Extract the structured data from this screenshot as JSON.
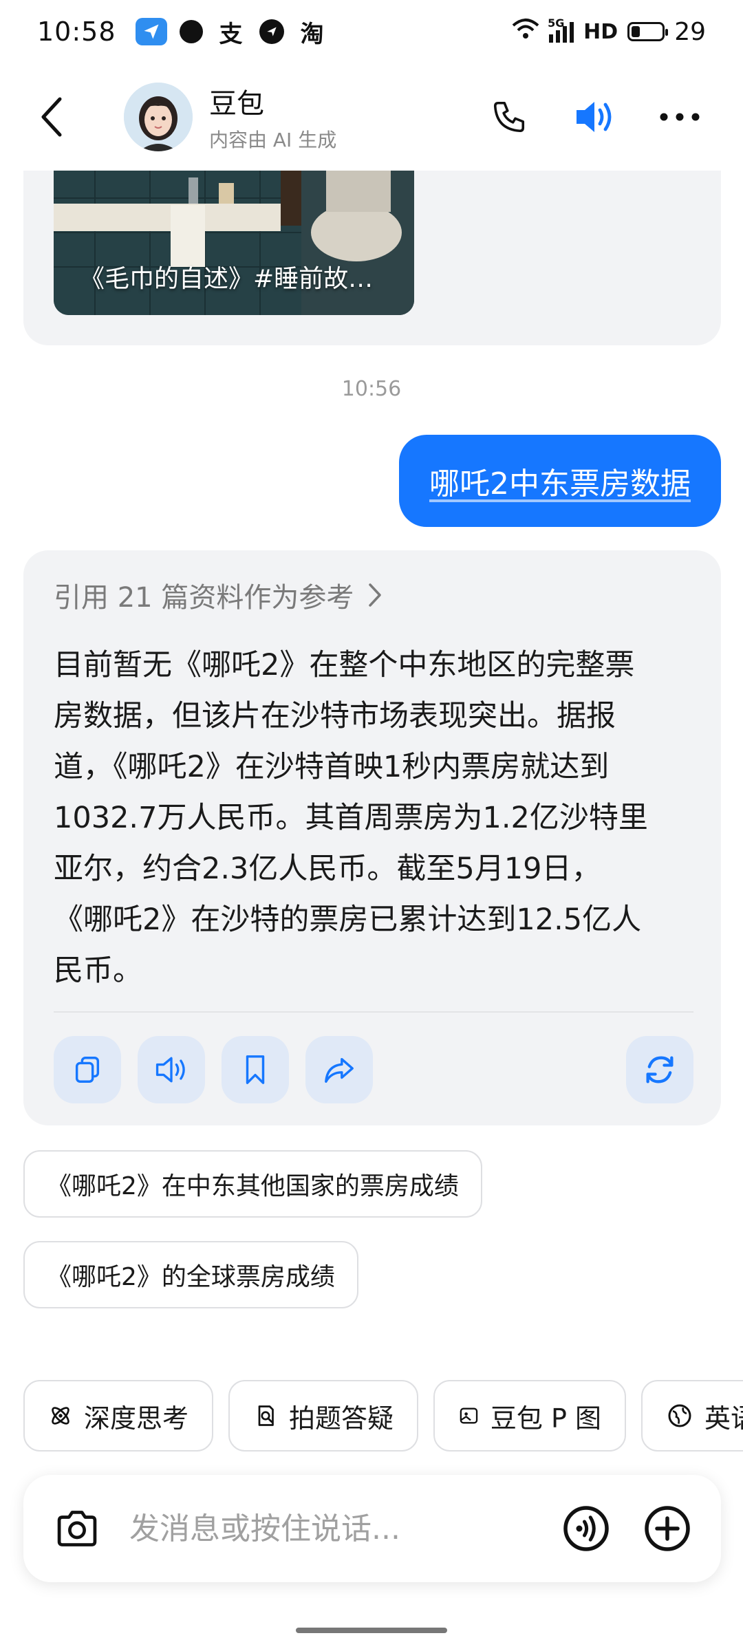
{
  "status_bar": {
    "time": "10:58",
    "app_icons": [
      "telegram-icon",
      "dot-icon",
      "alipay-icon",
      "send-icon",
      "taobao-icon"
    ],
    "alipay_glyph": "支",
    "taobao_glyph": "淘",
    "network_label": "5G",
    "hd_label": "HD",
    "battery_level": "29",
    "battery_fraction": 0.29
  },
  "header": {
    "title": "豆包",
    "subtitle": "内容由 AI 生成"
  },
  "prev_message": {
    "thumbnail_title": "《毛巾的自述》#睡前故…"
  },
  "chat": {
    "timestamp": "10:56",
    "user_message": "哪吒2中东票房数据",
    "reference_line": "引用 21 篇资料作为参考",
    "answer_lines": [
      "目前暂无《哪吒2》在整个中东地区的完整票",
      "房数据，但该片在沙特市场表现突出。据报",
      "道，《哪吒2》在沙特首映1秒内票房就达到",
      "1032.7万人民币。其首周票房为1.2亿沙特里",
      "亚尔，约合2.3亿人民币。截至5月19日，",
      "《哪吒2》在沙特的票房已累计达到12.5亿人",
      "民币。"
    ]
  },
  "suggestions": [
    "《哪吒2》在中东其他国家的票房成绩",
    "《哪吒2》的全球票房成绩"
  ],
  "tools": [
    {
      "label": "深度思考",
      "icon": "atom-icon"
    },
    {
      "label": "拍题答疑",
      "icon": "scan-question-icon"
    },
    {
      "label": "豆包 P 图",
      "icon": "image-edit-icon"
    },
    {
      "label": "英语",
      "icon": "globe-icon"
    }
  ],
  "input": {
    "placeholder": "发消息或按住说话..."
  },
  "colors": {
    "accent": "#1677ff",
    "card_bg": "#f2f3f5",
    "action_btn_bg": "#e0e9f7"
  }
}
